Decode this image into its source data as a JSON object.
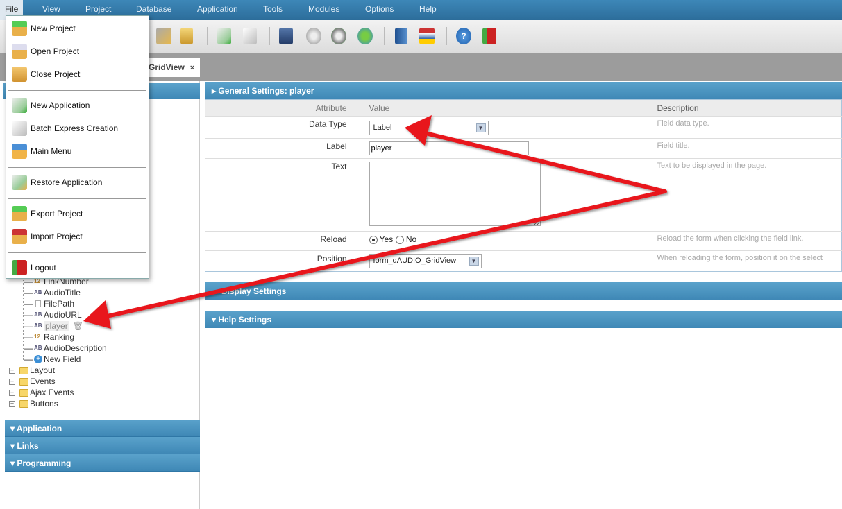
{
  "menubar": {
    "items": [
      "File",
      "View",
      "Project",
      "Database",
      "Application",
      "Tools",
      "Modules",
      "Options",
      "Help"
    ]
  },
  "toolbar": {
    "icons": [
      "edit-database-icon",
      "database-icon",
      "new-application-icon",
      "copy-application-icon",
      "save-icon",
      "generate-icon",
      "run-icon",
      "publish-icon",
      "documentation-icon",
      "language-icon",
      "help-icon",
      "exit-icon"
    ]
  },
  "tab": {
    "label": "GridView",
    "close": "×"
  },
  "file_menu": {
    "items": [
      "New Project",
      "Open Project",
      "Close Project",
      "New Application",
      "Batch Express Creation",
      "Main Menu",
      "Restore Application",
      "Export Project",
      "Import Project",
      "Logout"
    ]
  },
  "tree": {
    "fields": [
      "LinkNumber",
      "AudioTitle",
      "FilePath",
      "AudioURL",
      "player",
      "Ranking",
      "AudioDescription",
      "New Field"
    ],
    "folders": [
      "Layout",
      "Events",
      "Ajax Events",
      "Buttons"
    ]
  },
  "left_sections": [
    "Application",
    "Links",
    "Programming"
  ],
  "general": {
    "title": "General Settings: player",
    "headers": {
      "attribute": "Attribute",
      "value": "Value",
      "description": "Description"
    },
    "data_type": {
      "label": "Data Type",
      "value": "Label",
      "desc": "Field data type."
    },
    "label": {
      "label": "Label",
      "value": "player",
      "desc": "Field title."
    },
    "text": {
      "label": "Text",
      "value": "",
      "desc": "Text to be displayed in the page."
    },
    "reload": {
      "label": "Reload",
      "yes": "Yes",
      "no": "No",
      "selected": "Yes",
      "desc": "Reload the form when clicking the field link."
    },
    "position": {
      "label": "Position",
      "value": "form_dAUDIO_GridView",
      "desc": "When reloading the form, position it on the select"
    }
  },
  "display_settings": "Display Settings",
  "help_settings": "Help Settings",
  "annotation_color": "#e8141a"
}
